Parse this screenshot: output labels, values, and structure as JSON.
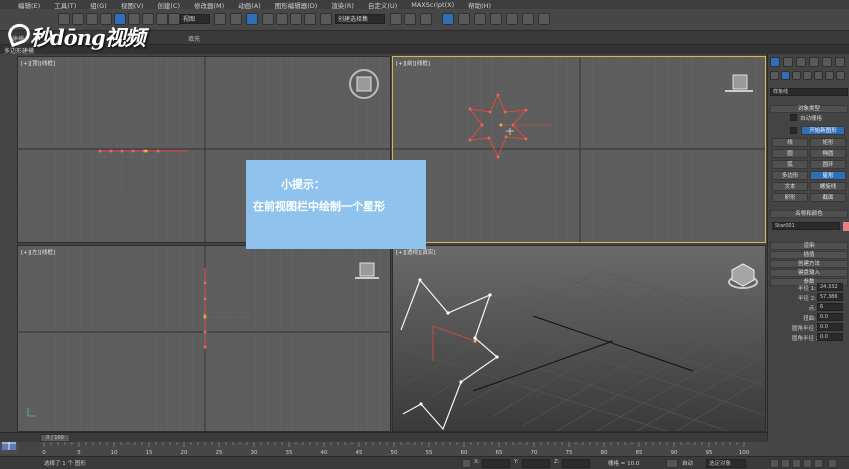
{
  "menu": [
    "编辑(E)",
    "工具(T)",
    "组(G)",
    "视图(V)",
    "创建(C)",
    "修改器(M)",
    "动画(A)",
    "图形编辑器(D)",
    "渲染(R)",
    "自定义(U)",
    "MAXScript(X)",
    "帮助(H)"
  ],
  "toolbar": {
    "viewcombo": "视图",
    "namedsel": "创建选择集"
  },
  "ribbon": {
    "tab_model": "建模",
    "tab_populate": "填充"
  },
  "subtab": "多边形建模",
  "logo": "秒dōng视频",
  "viewports": {
    "top": "[+][顶][线框]",
    "front": "[+][前][线框]",
    "left": "[+][左][线框]",
    "persp": "[+][透视][真实]"
  },
  "tip": {
    "title": "小提示：",
    "body": "在前视图栏中绘制一个星形"
  },
  "command_panel": {
    "category": "样条线",
    "object_type_header": "对象类型",
    "auto_grid": "自动栅格",
    "start_new_shape": "开始新图形",
    "buttons": [
      [
        "线",
        "矩形"
      ],
      [
        "圆",
        "椭圆"
      ],
      [
        "弧",
        "圆环"
      ],
      [
        "多边形",
        "星形"
      ],
      [
        "文本",
        "螺旋线"
      ],
      [
        "卵形",
        "截面"
      ]
    ],
    "name_color_header": "名称和颜色",
    "object_name": "Star001",
    "rollouts": [
      "渲染",
      "插值",
      "创建方法",
      "键盘输入",
      "参数"
    ],
    "params": [
      {
        "label": "半径 1:",
        "value": "24.332"
      },
      {
        "label": "半径 2:",
        "value": "57.386"
      },
      {
        "label": "点:",
        "value": "6"
      },
      {
        "label": "扭曲:",
        "value": "0.0"
      },
      {
        "label": "圆角半径 1:",
        "value": "0.0"
      },
      {
        "label": "圆角半径 2:",
        "value": "0.0"
      }
    ]
  },
  "timeline": {
    "frame": "0 / 100",
    "ticks": [
      "0",
      "5",
      "10",
      "15",
      "20",
      "25",
      "30",
      "35",
      "40",
      "45",
      "50",
      "55",
      "60",
      "65",
      "70",
      "75",
      "80",
      "85",
      "90",
      "95",
      "100"
    ]
  },
  "status": {
    "selected": "选择了 1 个 图形",
    "grid": "栅格 = 10.0",
    "auto": "自动",
    "selection_dropdown": "选定对象",
    "x": "X:",
    "y": "Y:",
    "z": "Z:"
  },
  "colors": {
    "accent_blue": "#2f6fb8",
    "active_viewport": "#d8b948",
    "tip_bg": "#8fc3ee",
    "spline": "#e04a3a"
  }
}
